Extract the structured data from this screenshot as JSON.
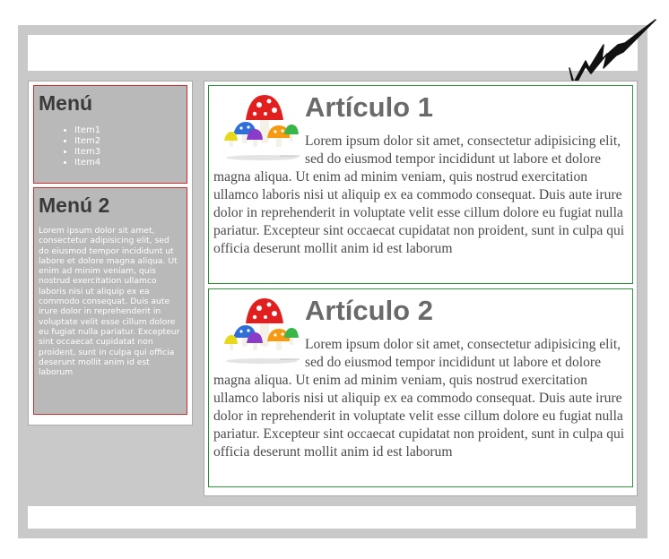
{
  "sidebar": {
    "menu1": {
      "title": "Menú",
      "items": [
        "Item1",
        "Item2",
        "Item3",
        "Item4"
      ]
    },
    "menu2": {
      "title": "Menú 2",
      "text": "Lorem ipsum dolor sit amet, consectetur adipisicing elit, sed do eiusmod tempor incididunt ut labore et dolore magna aliqua. Ut enim ad minim veniam, quis nostrud exercitation ullamco laboris nisi ut aliquip ex ea commodo consequat. Duis aute irure dolor in reprehenderit in voluptate velit esse cillum dolore eu fugiat nulla pariatur. Excepteur sint occaecat cupidatat non proident, sunt in culpa qui officia deserunt mollit anim id est laborum"
    }
  },
  "articles": [
    {
      "title": "Artículo 1",
      "text": "Lorem ipsum dolor sit amet, consectetur adipisicing elit, sed do eiusmod tempor incididunt ut labore et dolore magna aliqua. Ut enim ad minim veniam, quis nostrud exercitation ullamco laboris nisi ut aliquip ex ea commodo consequat. Duis aute irure dolor in reprehenderit in voluptate velit esse cillum dolore eu fugiat nulla pariatur. Excepteur sint occaecat cupidatat non proident, sunt in culpa qui officia deserunt mollit anim id est laborum"
    },
    {
      "title": "Artículo 2",
      "text": "Lorem ipsum dolor sit amet, consectetur adipisicing elit, sed do eiusmod tempor incididunt ut labore et dolore magna aliqua. Ut enim ad minim veniam, quis nostrud exercitation ullamco laboris nisi ut aliquip ex ea commodo consequat. Duis aute irure dolor in reprehenderit in voluptate velit esse cillum dolore eu fugiat nulla pariatur. Excepteur sint occaecat cupidatat non proident, sunt in culpa qui officia deserunt mollit anim id est laborum"
    }
  ],
  "icons": {
    "logo": "signature-logo-icon",
    "article_image": "mushrooms-icon"
  },
  "colors": {
    "page_background": "#c9c9c9",
    "menu_border": "#cc2b2b",
    "article_border": "#2e8b3a",
    "menu_background": "#b9b9b9"
  }
}
